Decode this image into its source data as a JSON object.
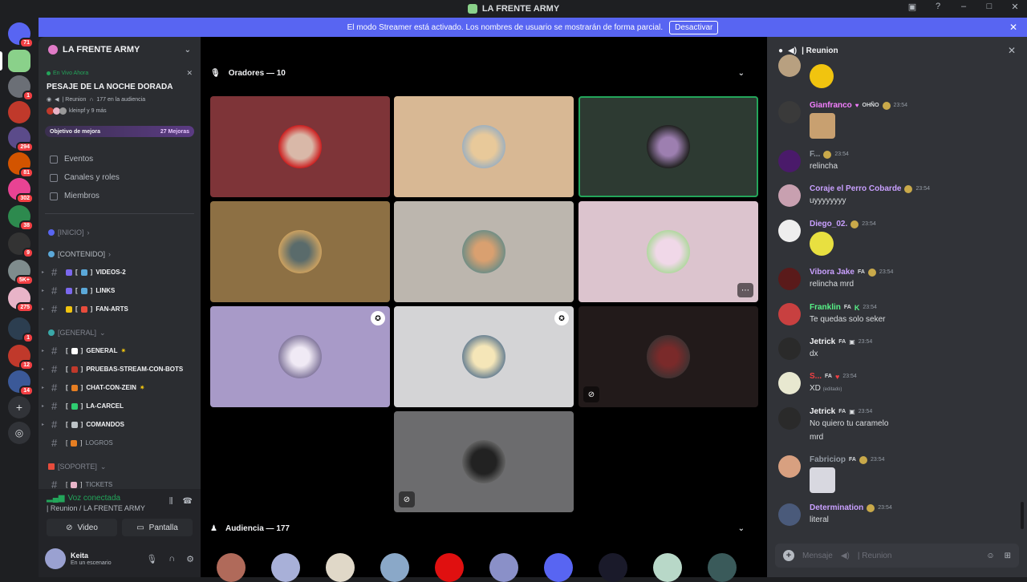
{
  "window": {
    "title": "LA FRENTE ARMY"
  },
  "rail": {
    "servers": [
      {
        "badge": "71",
        "color": "#5865f2"
      },
      {
        "badge": "",
        "color": "#8ad18a"
      },
      {
        "badge": "1",
        "color": "#6b6f76"
      },
      {
        "badge": "",
        "color": "#c0392b"
      },
      {
        "badge": "294",
        "color": "#5b4b8a"
      },
      {
        "badge": "81",
        "color": "#d35400"
      },
      {
        "badge": "302",
        "color": "#e84393"
      },
      {
        "badge": "38",
        "color": "#2d8a4e"
      },
      {
        "badge": "9",
        "color": "#333333"
      },
      {
        "badge": "5K+",
        "color": "#7f8c8d"
      },
      {
        "badge": "275",
        "color": "#e8b4c8"
      },
      {
        "badge": "1",
        "color": "#2c3e50"
      },
      {
        "badge": "12",
        "color": "#c0392b"
      },
      {
        "badge": "14",
        "color": "#3b5998"
      }
    ]
  },
  "banner": {
    "text": "El modo Streamer está activado. Los nombres de usuario se mostrarán de forma parcial.",
    "button": "Desactivar"
  },
  "sidebar": {
    "guild_name": "LA FRENTE ARMY",
    "live": {
      "label": "En Vivo Ahora",
      "title": "PESAJE DE LA NOCHE DORADA",
      "channel": "| Reunion",
      "audience": "177 en la audiencia",
      "users": "kleinpf y 9 más"
    },
    "boost": {
      "label": "Objetivo de mejora",
      "count": "27 Mejoras"
    },
    "nav": [
      "Eventos",
      "Canales y roles",
      "Miembros"
    ],
    "categories": {
      "inicio": "[INICIO]",
      "contenido": "[CONTENIDO]",
      "general": "[GENERAL]",
      "soporte": "[SOPORTE]"
    },
    "channels_contenido": [
      "VIDEOS-2",
      "LINKS",
      "FAN-ARTS"
    ],
    "channels_general": [
      "GENERAL",
      "PRUEBAS-STREAM-CON-BOTS",
      "CHAT-CON-ZEIN",
      "LA-CARCEL",
      "COMANDOS",
      "LOGROS"
    ],
    "channels_soporte": [
      "TICKETS"
    ],
    "voice": {
      "status": "Voz conectada",
      "location": "| Reunion / LA FRENTE ARMY",
      "video_btn": "Video",
      "screen_btn": "Pantalla"
    },
    "user": {
      "name": "Keita",
      "status": "En un escenario"
    }
  },
  "stage": {
    "speakers_header": "Oradores — 10",
    "audience_header": "Audiencia — 177"
  },
  "chat": {
    "channel": "| Reunion",
    "placeholder": "Mensaje",
    "placeholder_channel": "| Reunion",
    "messages": [
      {
        "name": "Gianfranco",
        "tag": "OHÑO",
        "time": "23:54",
        "text": "",
        "color": "#f47fff"
      },
      {
        "name": "F...",
        "tag": "",
        "time": "23:54",
        "text": "relincha",
        "color": "#949ba4"
      },
      {
        "name": "Coraje el Perro Cobarde",
        "tag": "",
        "time": "23:54",
        "text": "uyyyyyyyy",
        "color": "#c9a0ff"
      },
      {
        "name": "Diego_02.",
        "tag": "",
        "time": "23:54",
        "text": "",
        "color": "#c9a0ff"
      },
      {
        "name": "Vibora Jake",
        "tag": "FA",
        "time": "23:54",
        "text": "relincha mrd",
        "color": "#c9a0ff"
      },
      {
        "name": "Franklin",
        "tag": "FA",
        "time": "23:54",
        "text": "Te quedas solo seker",
        "color": "#57f287"
      },
      {
        "name": "Jetrick",
        "tag": "FA",
        "time": "23:54",
        "text": "dx",
        "color": "#f2f3f5"
      },
      {
        "name": "S...",
        "tag": "FA",
        "time": "23:54",
        "text": "XD",
        "edited": "(editado)",
        "color": "#f23f43"
      },
      {
        "name": "Jetrick",
        "tag": "FA",
        "time": "23:54",
        "text": "No quiero tu caramelo",
        "text2": "mrd",
        "color": "#f2f3f5"
      },
      {
        "name": "Fabriciop",
        "tag": "FA",
        "time": "23:54",
        "text": "",
        "color": "#949ba4"
      },
      {
        "name": "Determination",
        "tag": "",
        "time": "23:54",
        "text": "literal",
        "color": "#c9a0ff"
      }
    ]
  }
}
